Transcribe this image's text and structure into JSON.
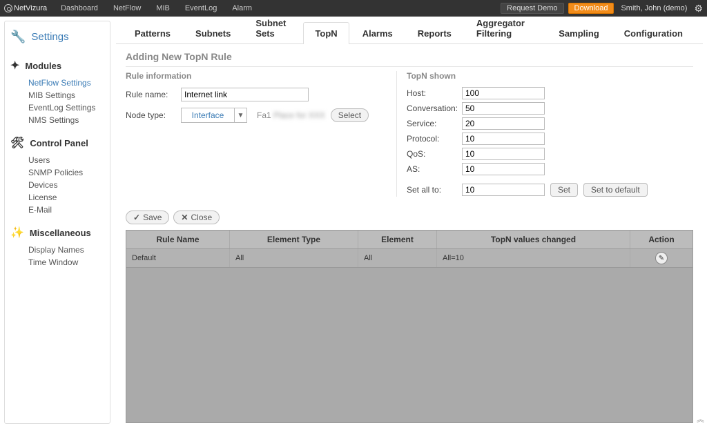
{
  "app": {
    "name": "NetVizura"
  },
  "topnav": [
    "Dashboard",
    "NetFlow",
    "MIB",
    "EventLog",
    "Alarm"
  ],
  "topbar": {
    "request_demo": "Request Demo",
    "download": "Download",
    "user": "Smith, John (demo)"
  },
  "sidebar": {
    "title": "Settings",
    "modules": {
      "title": "Modules",
      "items": [
        "NetFlow Settings",
        "MIB Settings",
        "EventLog Settings",
        "NMS Settings"
      ],
      "active_index": 0
    },
    "control_panel": {
      "title": "Control Panel",
      "items": [
        "Users",
        "SNMP Policies",
        "Devices",
        "License",
        "E-Mail"
      ]
    },
    "misc": {
      "title": "Miscellaneous",
      "items": [
        "Display Names",
        "Time Window"
      ]
    }
  },
  "tabs": [
    "Patterns",
    "Subnets",
    "Subnet Sets",
    "TopN",
    "Alarms",
    "Reports",
    "Aggregator Filtering",
    "Sampling",
    "Configuration"
  ],
  "active_tab_index": 3,
  "page": {
    "title": "Adding New TopN Rule",
    "rule": {
      "section_title": "Rule information",
      "name_label": "Rule name:",
      "name_value": "Internet link",
      "node_type_label": "Node type:",
      "node_type_value": "Interface",
      "node_selected": "Fa1",
      "node_selected_extra": "Place for XXX",
      "select_btn": "Select"
    },
    "topn": {
      "section_title": "TopN shown",
      "rows": [
        {
          "label": "Host:",
          "value": "100"
        },
        {
          "label": "Conversation:",
          "value": "50"
        },
        {
          "label": "Service:",
          "value": "20"
        },
        {
          "label": "Protocol:",
          "value": "10"
        },
        {
          "label": "QoS:",
          "value": "10"
        },
        {
          "label": "AS:",
          "value": "10"
        }
      ],
      "set_all_label": "Set all to:",
      "set_all_value": "10",
      "set_btn": "Set",
      "default_btn": "Set to default"
    },
    "actions": {
      "save": "Save",
      "close": "Close"
    }
  },
  "table": {
    "headers": [
      "Rule Name",
      "Element Type",
      "Element",
      "TopN values changed",
      "Action"
    ],
    "rows": [
      {
        "rule_name": "Default",
        "element_type": "All",
        "element": "All",
        "changed": "All=10"
      }
    ]
  }
}
